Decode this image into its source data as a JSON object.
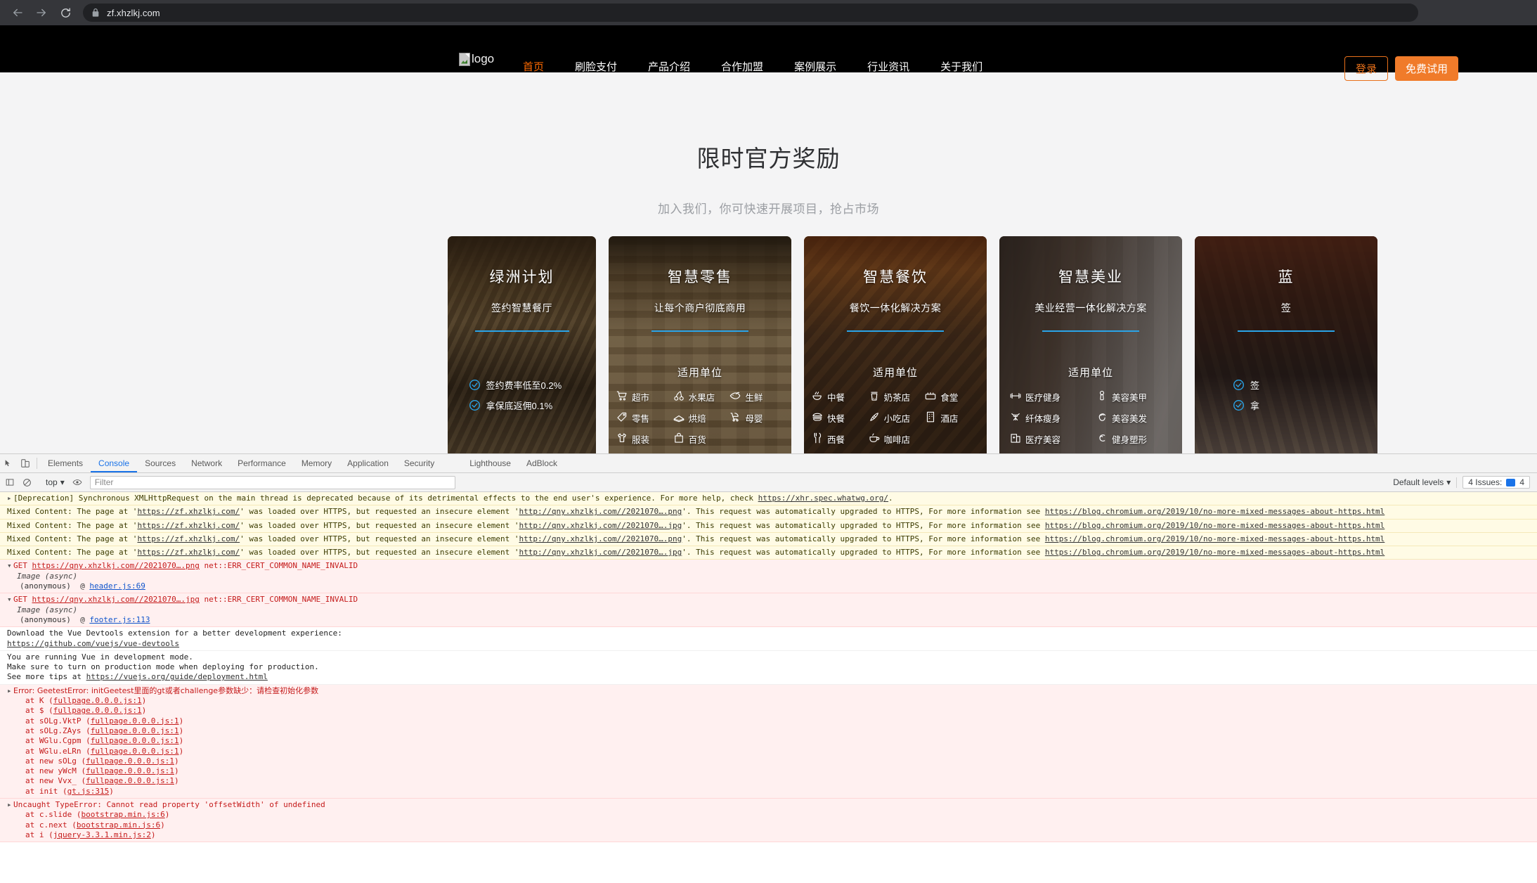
{
  "browser": {
    "url": "zf.xhzlkj.com",
    "back_icon": "back-arrow-icon",
    "forward_icon": "forward-arrow-icon",
    "reload_icon": "reload-icon",
    "lock_icon": "lock-icon"
  },
  "site": {
    "logo_alt": "logo",
    "nav": [
      {
        "label": "首页",
        "active": true
      },
      {
        "label": "刷脸支付",
        "active": false
      },
      {
        "label": "产品介绍",
        "active": false
      },
      {
        "label": "合作加盟",
        "active": false
      },
      {
        "label": "案例展示",
        "active": false
      },
      {
        "label": "行业资讯",
        "active": false
      },
      {
        "label": "关于我们",
        "active": false
      }
    ],
    "login_label": "登录",
    "trial_label": "免费试用",
    "accent_orange": "#f07b2a",
    "accent_blue": "#2aa4e8"
  },
  "hero": {
    "title": "限时官方奖励",
    "subtitle": "加入我们，你可快速开展项目，抢占市场"
  },
  "cards": [
    {
      "title": "绿洲计划",
      "subtitle": "签约智慧餐厅",
      "type": "checks",
      "checks": [
        "签约费率低至0.2%",
        "拿保底返佣0.1%"
      ]
    },
    {
      "title": "智慧零售",
      "subtitle": "让每个商户彻底商用",
      "type": "units",
      "unit_label": "适用单位",
      "units": [
        {
          "icon": "shopping-cart-icon",
          "label": "超市"
        },
        {
          "icon": "cherry-icon",
          "label": "水果店"
        },
        {
          "icon": "fish-icon",
          "label": "生鲜"
        },
        {
          "icon": "price-tag-icon",
          "label": "零售"
        },
        {
          "icon": "cake-icon",
          "label": "烘焙"
        },
        {
          "icon": "stroller-icon",
          "label": "母婴"
        },
        {
          "icon": "tshirt-icon",
          "label": "服装"
        },
        {
          "icon": "shopping-bag-icon",
          "label": "百货"
        }
      ]
    },
    {
      "title": "智慧餐饮",
      "subtitle": "餐饮一体化解决方案",
      "type": "units",
      "unit_label": "适用单位",
      "units": [
        {
          "icon": "noodles-bowl-icon",
          "label": "中餐"
        },
        {
          "icon": "bubble-tea-icon",
          "label": "奶茶店"
        },
        {
          "icon": "canteen-icon",
          "label": "食堂"
        },
        {
          "icon": "burger-icon",
          "label": "快餐"
        },
        {
          "icon": "snack-icon",
          "label": "小吃店"
        },
        {
          "icon": "hotel-building-icon",
          "label": "酒店"
        },
        {
          "icon": "fork-knife-icon",
          "label": "西餐"
        },
        {
          "icon": "coffee-cup-icon",
          "label": "咖啡店"
        }
      ]
    },
    {
      "title": "智慧美业",
      "subtitle": "美业经营一体化解决方案",
      "type": "units",
      "unit_label": "适用单位",
      "units": [
        {
          "icon": "dumbbell-icon",
          "label": "医疗健身"
        },
        {
          "icon": "nail-polish-icon",
          "label": "美容美甲"
        },
        {
          "icon": "slimming-icon",
          "label": "纤体瘦身"
        },
        {
          "icon": "hairstyle-icon",
          "label": "美容美发"
        },
        {
          "icon": "hospital-icon",
          "label": "医疗美容"
        },
        {
          "icon": "muscle-arm-icon",
          "label": "健身塑形"
        }
      ]
    },
    {
      "title": "蓝",
      "subtitle": "签",
      "type": "checks",
      "checks": [
        "签",
        "拿"
      ]
    }
  ],
  "devtools": {
    "tabs": [
      "Elements",
      "Console",
      "Sources",
      "Network",
      "Performance",
      "Memory",
      "Application",
      "Security",
      "Lighthouse",
      "AdBlock"
    ],
    "active_tab": "Console",
    "inspect_icon": "inspect-element-icon",
    "device_icon": "device-toolbar-icon",
    "clear_icon": "clear-console-icon",
    "eye_icon": "live-expression-icon",
    "context": "top",
    "filter_placeholder": "Filter",
    "levels": "Default levels",
    "issues_label": "4 Issues:",
    "issues_count": "4"
  },
  "console": {
    "messages": [
      {
        "kind": "warn",
        "arrow": "▸",
        "text": "[Deprecation] Synchronous XMLHttpRequest on the main thread is deprecated because of its detrimental effects to the end user's experience. For more help, check ",
        "link": "https://xhr.spec.whatwg.org/",
        "tail": "."
      },
      {
        "kind": "warn",
        "pre": "Mixed Content: The page at '",
        "link1": "https://zf.xhzlkj.com/",
        "mid": "' was loaded over HTTPS, but requested an insecure element '",
        "link2": "http://qny.xhzlkj.com//2021070….png",
        "post": "'. This request was automatically upgraded to HTTPS, For more information see ",
        "link3": "https://blog.chromium.org/2019/10/no-more-mixed-messages-about-https.html"
      },
      {
        "kind": "warn",
        "pre": "Mixed Content: The page at '",
        "link1": "https://zf.xhzlkj.com/",
        "mid": "' was loaded over HTTPS, but requested an insecure element '",
        "link2": "http://qny.xhzlkj.com//2021070….jpg",
        "post": "'. This request was automatically upgraded to HTTPS, For more information see ",
        "link3": "https://blog.chromium.org/2019/10/no-more-mixed-messages-about-https.html"
      },
      {
        "kind": "warn",
        "pre": "Mixed Content: The page at '",
        "link1": "https://zf.xhzlkj.com/",
        "mid": "' was loaded over HTTPS, but requested an insecure element '",
        "link2": "http://qny.xhzlkj.com//2021070….png",
        "post": "'. This request was automatically upgraded to HTTPS, For more information see ",
        "link3": "https://blog.chromium.org/2019/10/no-more-mixed-messages-about-https.html"
      },
      {
        "kind": "warn",
        "pre": "Mixed Content: The page at '",
        "link1": "https://zf.xhzlkj.com/",
        "mid": "' was loaded over HTTPS, but requested an insecure element '",
        "link2": "http://qny.xhzlkj.com//2021070….jpg",
        "post": "'. This request was automatically upgraded to HTTPS, For more information see ",
        "link3": "https://blog.chromium.org/2019/10/no-more-mixed-messages-about-https.html"
      }
    ],
    "net_errors": [
      {
        "method": "GET",
        "url": "https://qny.xhzlkj.com//2021070….png",
        "error": "net::ERR_CERT_COMMON_NAME_INVALID",
        "async": "Image (async)",
        "frame": "(anonymous)",
        "source": "header.js:69"
      },
      {
        "method": "GET",
        "url": "https://qny.xhzlkj.com//2021070….jpg",
        "error": "net::ERR_CERT_COMMON_NAME_INVALID",
        "async": "Image (async)",
        "frame": "(anonymous)",
        "source": "footer.js:113"
      }
    ],
    "vue_notice": {
      "line1": "Download the Vue Devtools extension for a better development experience:",
      "link1": "https://github.com/vuejs/vue-devtools",
      "line2": "You are running Vue in development mode.",
      "line3": "Make sure to turn on production mode when deploying for production.",
      "line4_pre": "See more tips at ",
      "link2": "https://vuejs.org/guide/deployment.html"
    },
    "geetest_error": {
      "arrow": "▸",
      "title": "Error: GeetestError: initGeetest里面的gt或者challenge参数缺少：请检查初始化参数",
      "stack": [
        {
          "fn": "at K (",
          "src": "fullpage.0.0.0.js:1",
          "close": ")"
        },
        {
          "fn": "at $ (",
          "src": "fullpage.0.0.0.js:1",
          "close": ")"
        },
        {
          "fn": "at sOLg.VktP (",
          "src": "fullpage.0.0.0.js:1",
          "close": ")"
        },
        {
          "fn": "at sOLg.ZAys (",
          "src": "fullpage.0.0.0.js:1",
          "close": ")"
        },
        {
          "fn": "at WGlu.Cgpm (",
          "src": "fullpage.0.0.0.js:1",
          "close": ")"
        },
        {
          "fn": "at WGlu.eLRn (",
          "src": "fullpage.0.0.0.js:1",
          "close": ")"
        },
        {
          "fn": "at new sOLg (",
          "src": "fullpage.0.0.0.js:1",
          "close": ")"
        },
        {
          "fn": "at new yWcM (",
          "src": "fullpage.0.0.0.js:1",
          "close": ")"
        },
        {
          "fn": "at new Vvx_ (",
          "src": "fullpage.0.0.0.js:1",
          "close": ")"
        },
        {
          "fn": "at init (",
          "src": "gt.js:315",
          "close": ")"
        }
      ]
    },
    "type_error": {
      "arrow": "▸",
      "title": "Uncaught TypeError: Cannot read property 'offsetWidth' of undefined",
      "stack": [
        {
          "fn": "at c.slide (",
          "src": "bootstrap.min.js:6",
          "close": ")"
        },
        {
          "fn": "at c.next (",
          "src": "bootstrap.min.js:6",
          "close": ")"
        },
        {
          "fn": "at i (",
          "src": "jquery-3.3.1.min.js:2",
          "close": ")"
        }
      ]
    }
  }
}
